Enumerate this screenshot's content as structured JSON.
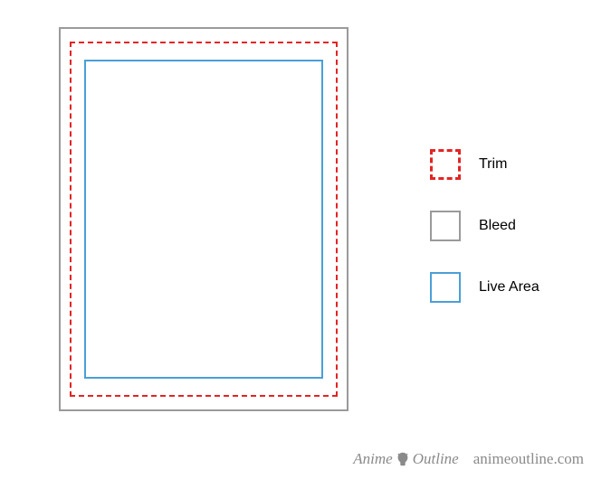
{
  "legend": {
    "items": [
      {
        "key": "trim",
        "label": "Trim"
      },
      {
        "key": "bleed",
        "label": "Bleed"
      },
      {
        "key": "live",
        "label": "Live Area"
      }
    ]
  },
  "colors": {
    "trim": "#e32424",
    "bleed": "#9a9a9a",
    "live": "#4a9fd8"
  },
  "watermark": {
    "brand_left": "Anime",
    "brand_right": "Outline",
    "url": "animeoutline.com"
  }
}
